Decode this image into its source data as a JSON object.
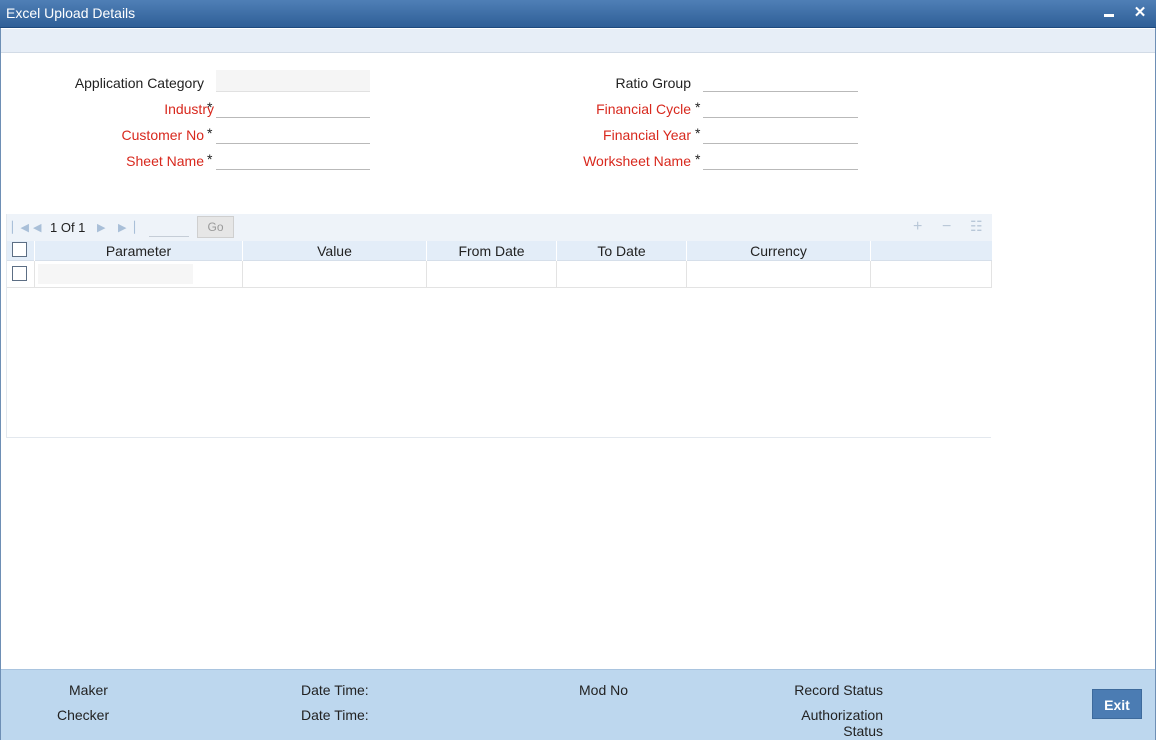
{
  "window": {
    "title": "Excel Upload Details",
    "minimize_icon": "minimize-icon",
    "close_icon": "close-icon",
    "close_glyph": "✕"
  },
  "form": {
    "application_category": {
      "label": "Application Category",
      "value": ""
    },
    "industry": {
      "label": "Industry",
      "required": "*",
      "value": ""
    },
    "customer_no": {
      "label": "Customer No",
      "required": "*",
      "value": ""
    },
    "sheet_name": {
      "label": "Sheet Name",
      "required": "*",
      "value": ""
    },
    "ratio_group": {
      "label": "Ratio Group",
      "value": ""
    },
    "financial_cycle": {
      "label": "Financial Cycle",
      "required": "*",
      "value": ""
    },
    "financial_year": {
      "label": "Financial Year",
      "required": "*",
      "value": ""
    },
    "worksheet_name": {
      "label": "Worksheet Name",
      "required": "*",
      "value": ""
    }
  },
  "grid": {
    "pagination": {
      "text": "1 Of 1",
      "go_label": "Go",
      "page_input": ""
    },
    "nav_icons": [
      "first-page-icon",
      "prev-page-icon",
      "next-page-icon",
      "last-page-icon"
    ],
    "tool_icons": [
      "add-row-icon",
      "delete-row-icon",
      "view-details-icon"
    ],
    "columns": [
      "Parameter",
      "Value",
      "From Date",
      "To Date",
      "Currency"
    ],
    "rows": [
      {
        "Parameter": "",
        "Value": "",
        "From Date": "",
        "To Date": "",
        "Currency": ""
      }
    ]
  },
  "footer": {
    "maker": "Maker",
    "checker": "Checker",
    "date_time_1": "Date Time:",
    "date_time_2": "Date Time:",
    "mod_no": "Mod No",
    "record_status": "Record Status",
    "authorization_status_line1": "Authorization",
    "authorization_status_line2": "Status",
    "exit_label": "Exit"
  },
  "colors": {
    "title_bar": "#2f5f97",
    "required_label": "#d8281d",
    "footer_bg": "#bdd7ee",
    "exit_button": "#4b7cb3"
  }
}
